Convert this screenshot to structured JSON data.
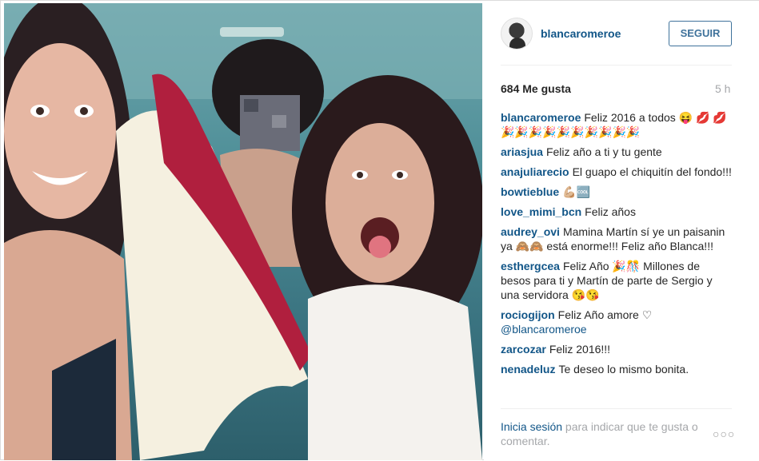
{
  "post": {
    "photo_alt_name": "post-photo",
    "author": {
      "username": "blancaromeroe",
      "follow_label": "SEGUIR"
    },
    "likes_label": "684 Me gusta",
    "time_label": "5 h",
    "comments": [
      {
        "user": "blancaromeroe",
        "text": "Feliz 2016 a todos 😝 💋 💋 🎉🎉🎉🎉🎉🎉🎉🎉🎉🎉"
      },
      {
        "user": "ariasjua",
        "text": "Feliz año a ti y tu gente"
      },
      {
        "user": "anajuliarecio",
        "text": "El guapo el chiquitín del fondo!!!"
      },
      {
        "user": "bowtieblue",
        "text": "💪🏼🆒"
      },
      {
        "user": "love_mimi_bcn",
        "text": "Feliz años"
      },
      {
        "user": "audrey_ovi",
        "text": "Mamina Martín sí ye un paisanin ya 🙈🙈 está enorme!!! Feliz año Blanca!!!"
      },
      {
        "user": "esthergcea",
        "text": "Feliz Año 🎉🎊 Millones de besos para ti y Martín de parte de Sergio y una servidora 😘😘"
      },
      {
        "user": "rociogijon",
        "text": "Feliz Año amore ♡",
        "mention": "@blancaromeroe"
      },
      {
        "user": "zarcozar",
        "text": "Feliz 2016!!!"
      },
      {
        "user": "nenadeluz",
        "text": "Te deseo lo mismo bonita."
      }
    ],
    "footer": {
      "login_label": "Inicia sesión",
      "rest_label": " para indicar que te gusta o comentar.",
      "more_label": "○○○"
    }
  }
}
